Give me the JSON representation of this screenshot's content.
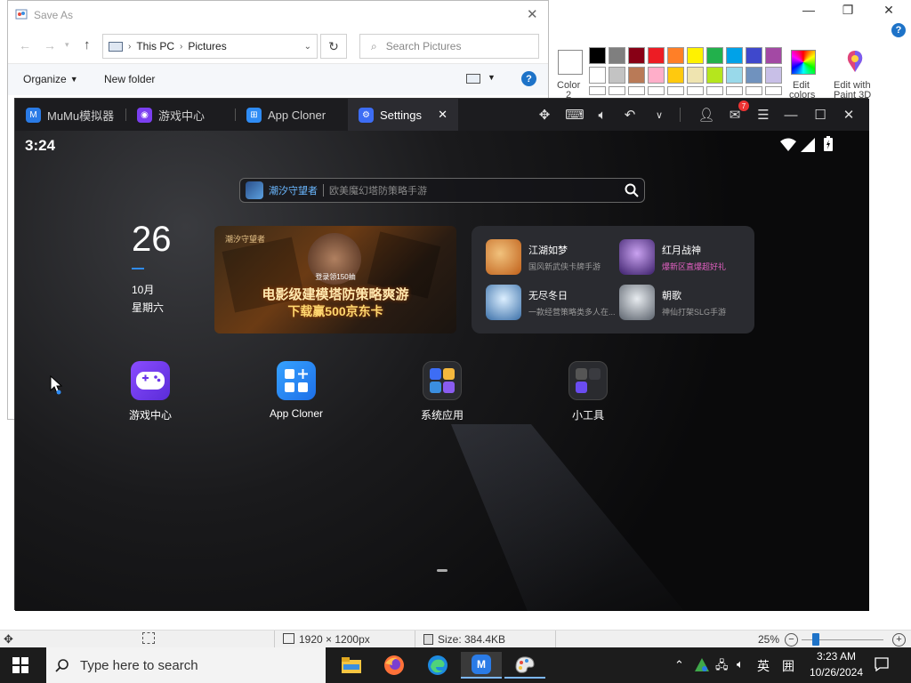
{
  "paint": {
    "color2_label": "Color",
    "color2_sub": "2",
    "edit_colors": "Edit",
    "edit_colors_sub": "colors",
    "edit_with": "Edit with",
    "paint3d": "Paint 3D",
    "palette_row1": [
      "#000000",
      "#7f7f7f",
      "#880015",
      "#ed1c24",
      "#ff7f27",
      "#fff200",
      "#22b14c",
      "#00a2e8",
      "#3f48cc",
      "#a349a4"
    ],
    "palette_row2": [
      "#ffffff",
      "#c3c3c3",
      "#b97a57",
      "#ffaec9",
      "#ffc90e",
      "#efe4b0",
      "#b5e61d",
      "#99d9ea",
      "#7092be",
      "#c8bfe7"
    ]
  },
  "save_as": {
    "title": "Save As",
    "breadcrumb": [
      "This PC",
      "Pictures"
    ],
    "search_placeholder": "Search Pictures",
    "organize": "Organize",
    "new_folder": "New folder"
  },
  "emulator": {
    "tabs": [
      {
        "label": "MuMu模拟器"
      },
      {
        "label": "游戏中心"
      },
      {
        "label": "App Cloner"
      },
      {
        "label": "Settings"
      }
    ],
    "notif_count": "7",
    "clock": "3:24",
    "search_tag": "潮汐守望者",
    "search_placeholder": "欧美魔幻塔防策略手游",
    "date_day": "26",
    "date_month": "10月",
    "date_weekday": "星期六",
    "banner": {
      "logo": "潮汐守望者",
      "tag": "登录领150抽",
      "headline": "电影级建模塔防策略爽游",
      "subline": "下载赢500京东卡"
    },
    "games": [
      {
        "name": "江湖如梦",
        "desc": "国风新武侠卡牌手游",
        "color": "#c0601a"
      },
      {
        "name": "红月战神",
        "desc": "爆新区直爆超好礼",
        "color": "#6a3fa0"
      },
      {
        "name": "无尽冬日",
        "desc": "一款经营策略类多人在...",
        "color": "#4c7fb8"
      },
      {
        "name": "朝歌",
        "desc": "神仙打架SLG手游",
        "color": "#8a8f97"
      }
    ],
    "desktop": [
      {
        "label": "游戏中心"
      },
      {
        "label": "App Cloner"
      },
      {
        "label": "系统应用"
      },
      {
        "label": "小工具"
      }
    ]
  },
  "statusbar": {
    "dimensions": "1920 × 1200px",
    "size": "Size: 384.4KB",
    "zoom": "25%",
    "zoom_level": 0.25
  },
  "taskbar": {
    "search_placeholder": "Type here to search",
    "ime": "英",
    "time": "3:23 AM",
    "date": "10/26/2024"
  }
}
